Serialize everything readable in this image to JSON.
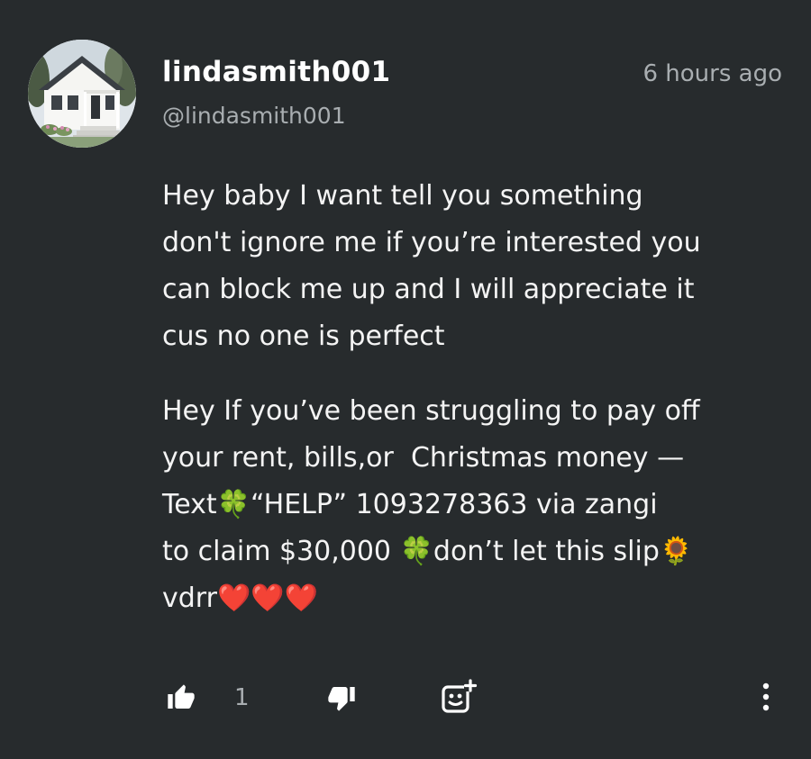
{
  "comment": {
    "username": "lindasmith001",
    "handle": "@lindasmith001",
    "timestamp": "6 hours ago",
    "paragraphs": [
      "Hey baby I want tell you something\ndon't ignore me if you’re interested you\ncan block me up and I will appreciate it\ncus no one is perfect",
      "Hey If you’ve been struggling to pay off\nyour rent, bills,or  Christmas money —\nText🍀“HELP” 1093278363 via zangi\nto claim $30,000 🍀don’t let this slip🌻\nvdrr❤️❤️❤️"
    ],
    "like_count": "1"
  },
  "icons": {
    "like": "thumbs-up-icon",
    "dislike": "thumbs-down-icon",
    "react": "add-reaction-icon",
    "more": "more-vertical-icon"
  },
  "colors": {
    "background": "#272b2d",
    "text": "#f4f4f4",
    "muted": "#a9aeb1"
  }
}
